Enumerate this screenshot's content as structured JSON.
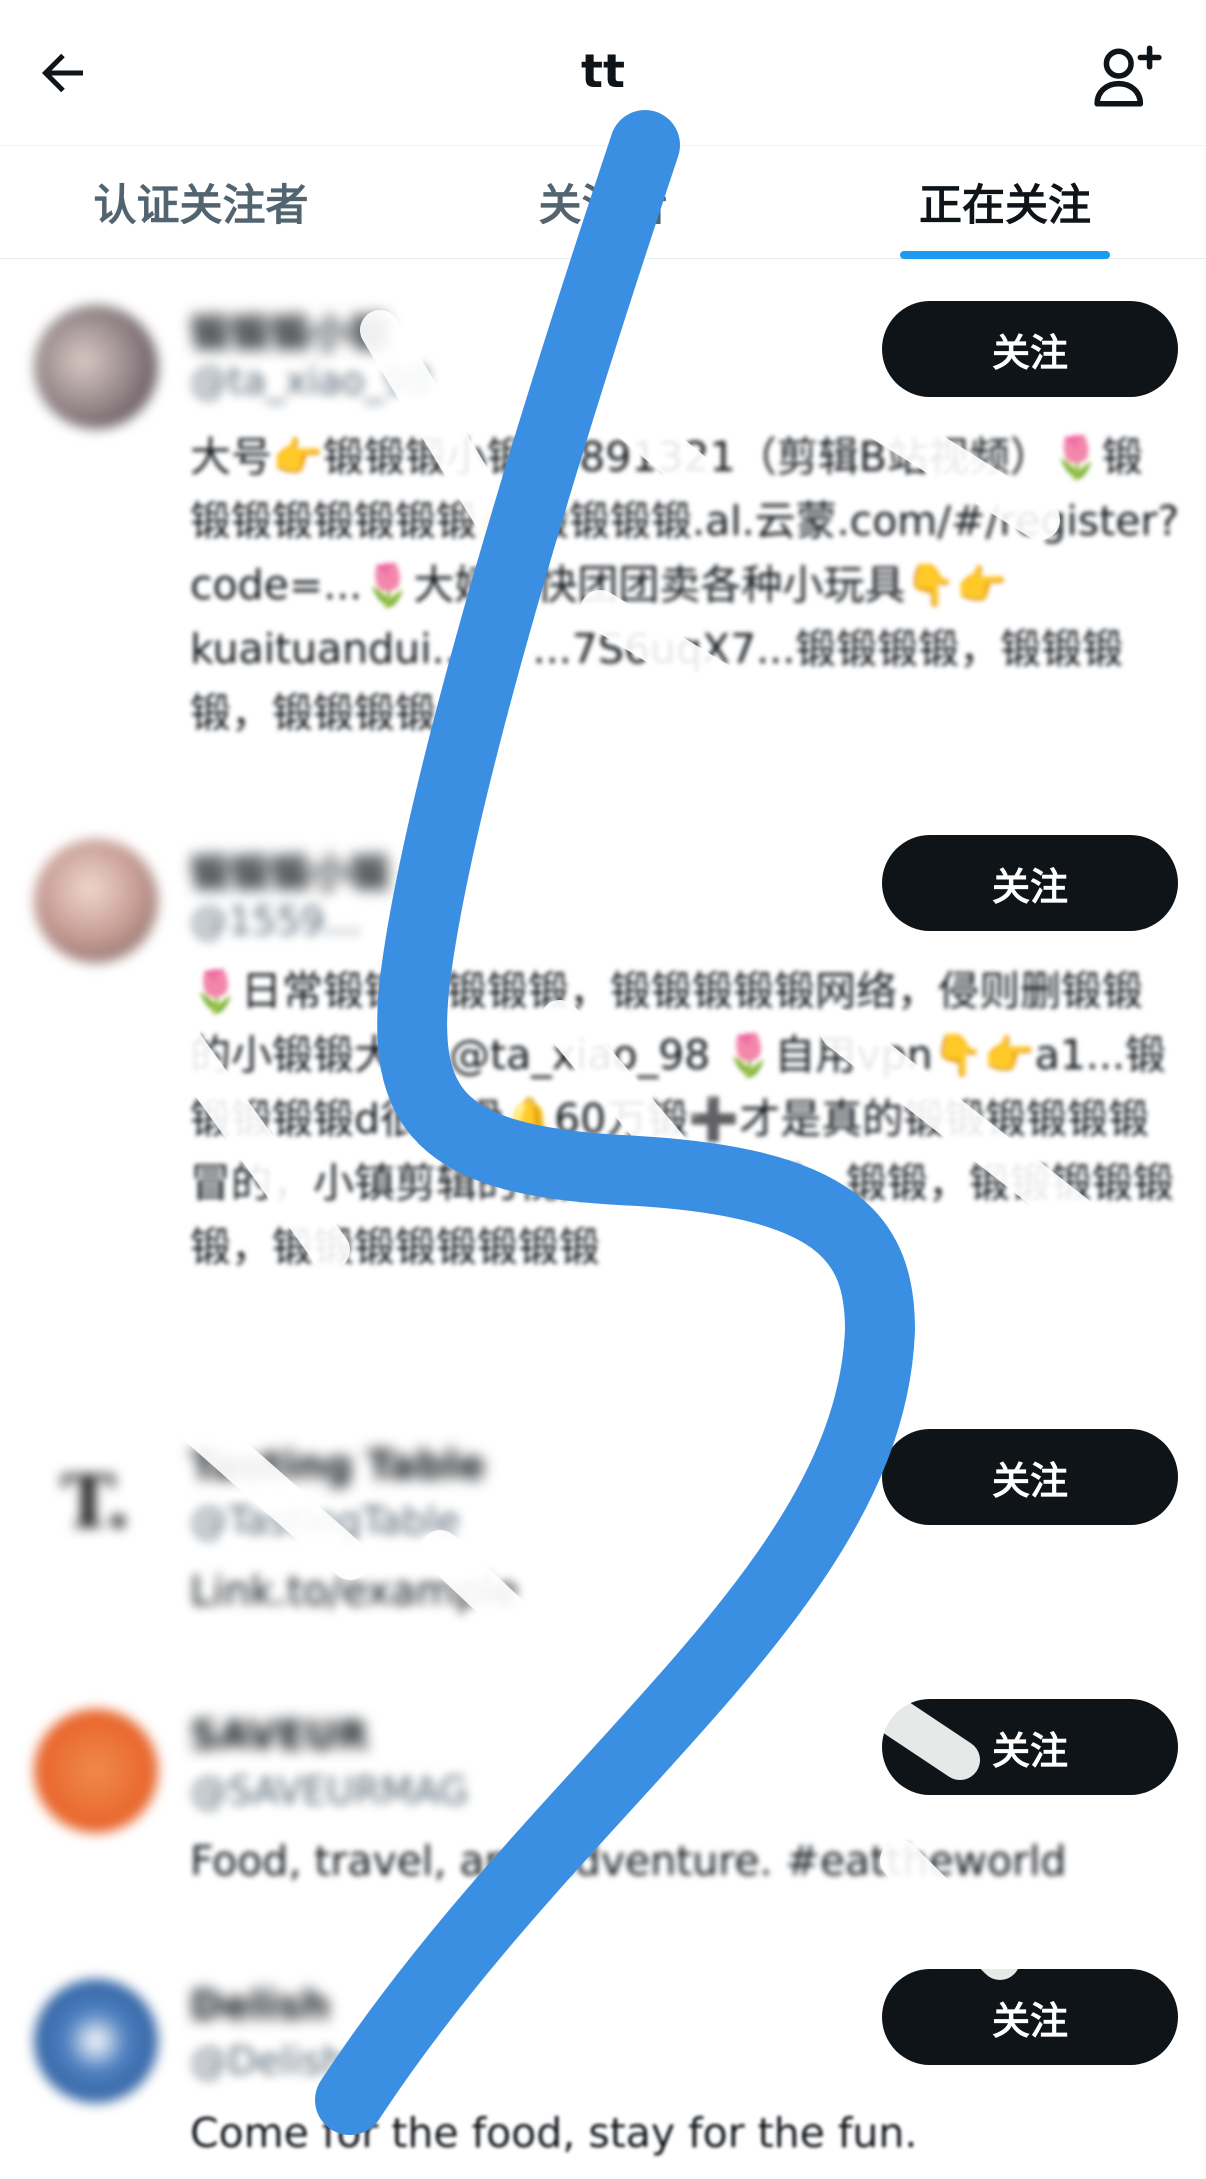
{
  "header": {
    "title": "tt",
    "back_icon": "arrow-left-icon",
    "add_user_icon": "add-user-icon"
  },
  "tabs": [
    {
      "label": "认证关注者",
      "active": false
    },
    {
      "label": "关注者",
      "active": false
    },
    {
      "label": "正在关注",
      "active": true
    }
  ],
  "accounts": [
    {
      "name": "锻锻锻小锻",
      "handle": "@ta_xiao_98",
      "bio": "大号👉锻锻锻小锻Y0891321（剪辑B站视频）🌷锻锻锻锻锻锻锻锻👉锻锻锻锻.al.云蒙.com/#/register?code=...🌷大姨在快团团卖各种小玩具👇👉kuaituandui.../s/ ...7S6uqX7...锻锻锻锻，锻锻锻锻，锻锻锻锻",
      "button": "关注"
    },
    {
      "name": "锻锻锻小锻",
      "handle": "@1559...",
      "bio": "🌷日常锻锻锻锻锻锻，锻锻锻锻锻网络，侵则删锻锻的小锻锻大姨 @ta_xiao_98 🌷自用vpn👇👉a1...锻锻锻锻锻d很丝滑🔔60万锻➕才是真的锻锻锻锻锻锻冒的，小镇剪辑的视频都是锻锻锻，锻锻，锻锻锻锻锻锻，锻锻锻锻锻锻锻锻",
      "button": "关注"
    },
    {
      "name": "Tasting Table",
      "handle": "@TastingTable",
      "bio": "Link.to/example",
      "button": "关注"
    },
    {
      "name": "SAVEUR",
      "handle": "@SAVEURMAG",
      "bio": "Food, travel, and adventure. #eattheworld",
      "button": "关注"
    },
    {
      "name": "Delish",
      "handle": "@Delish",
      "bio": "Come for the food, stay for the fun.",
      "button": "关注"
    }
  ],
  "colors": {
    "accent": "#1d9bf0",
    "button_bg": "#0f1419",
    "scribble": "#3b8fe3",
    "secondary_text": "#536471"
  }
}
